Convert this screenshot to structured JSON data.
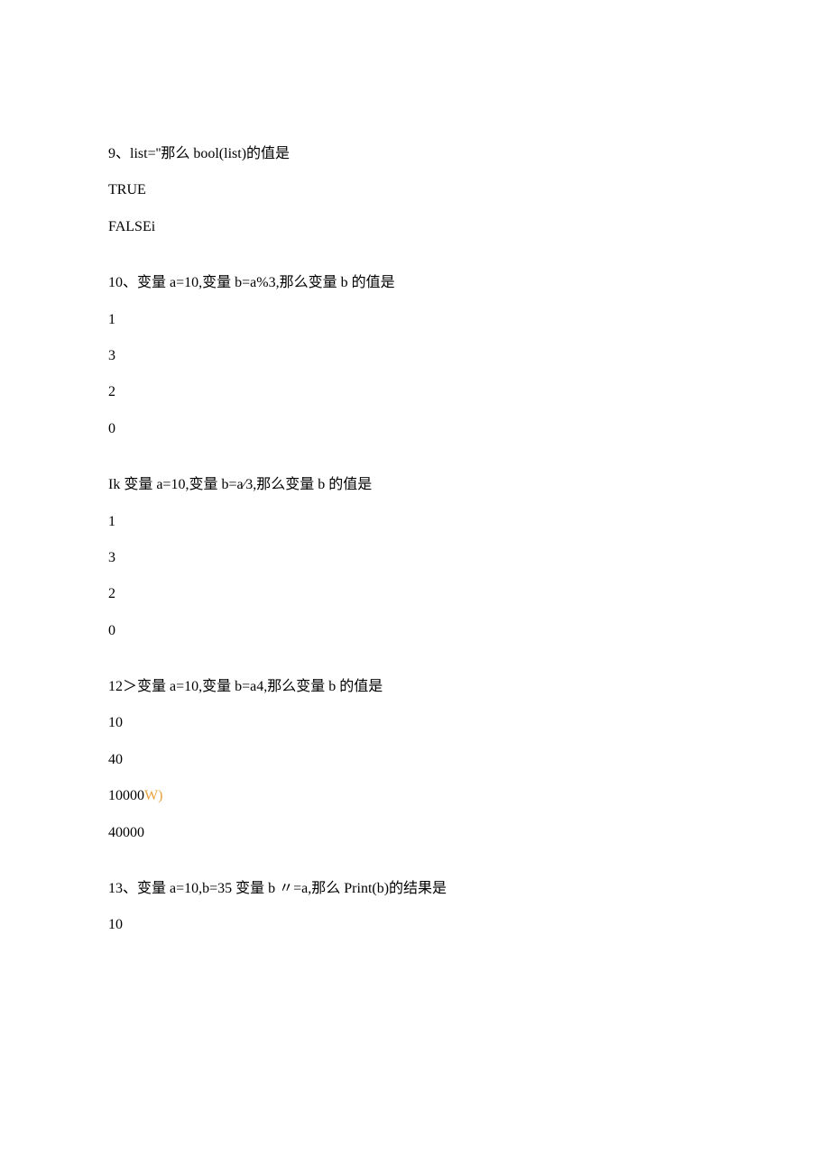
{
  "q9": {
    "text": "9、list=''那么 bool(list)的值是",
    "options": [
      "TRUE",
      "FALSEi"
    ]
  },
  "q10": {
    "text": "10、变量 a=10,变量 b=a%3,那么变量 b 的值是",
    "options": [
      "1",
      "3",
      "2",
      "0"
    ]
  },
  "q11": {
    "text": "Ik 变量 a=10,变量 b=a⁄3,那么变量 b 的值是",
    "options": [
      "1",
      "3",
      "2",
      "0"
    ]
  },
  "q12": {
    "text": "12＞变量 a=10,变量 b=a4,那么变量 b 的值是",
    "options": [
      "10",
      "40"
    ],
    "opt3_prefix": "10000",
    "opt3_suffix": "W)",
    "opt4": "40000"
  },
  "q13": {
    "text": "13、变量 a=10,b=35 变量 b 〃=a,那么 Print(b)的结果是",
    "options": [
      "10"
    ]
  }
}
